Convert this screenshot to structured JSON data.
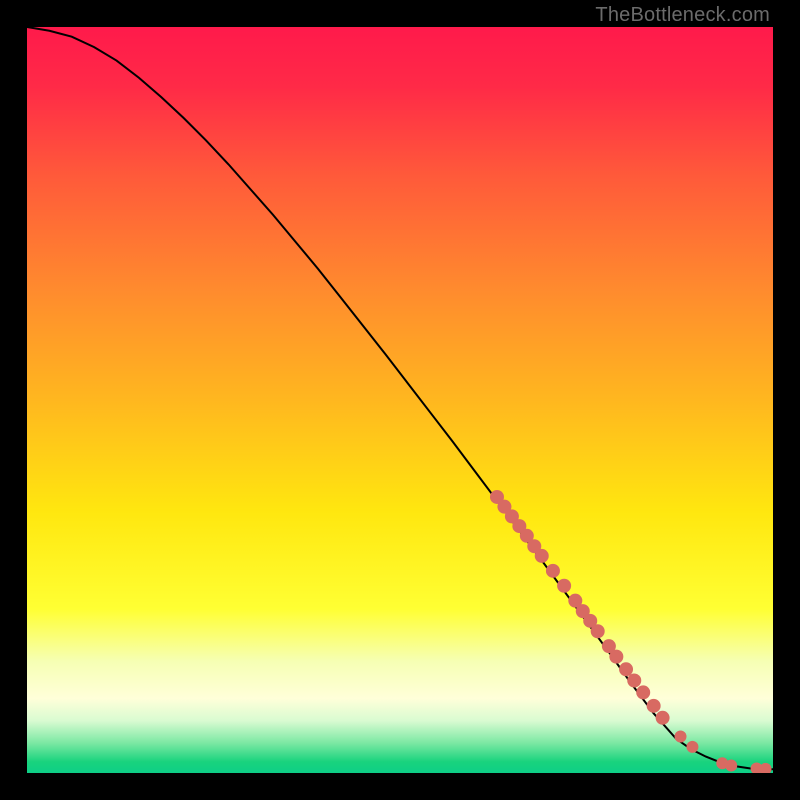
{
  "watermark": "TheBottleneck.com",
  "chart_data": {
    "type": "line",
    "title": "",
    "xlabel": "",
    "ylabel": "",
    "xlim": [
      0,
      100
    ],
    "ylim": [
      0,
      100
    ],
    "grid": false,
    "background_gradient": [
      {
        "stop": 0.0,
        "color": "#ff1a4b"
      },
      {
        "stop": 0.08,
        "color": "#ff2a47"
      },
      {
        "stop": 0.2,
        "color": "#ff5a3a"
      },
      {
        "stop": 0.35,
        "color": "#ff8a2e"
      },
      {
        "stop": 0.5,
        "color": "#ffb71f"
      },
      {
        "stop": 0.65,
        "color": "#ffe70f"
      },
      {
        "stop": 0.78,
        "color": "#ffff33"
      },
      {
        "stop": 0.85,
        "color": "#f6ffb3"
      },
      {
        "stop": 0.9,
        "color": "#ffffd9"
      },
      {
        "stop": 0.93,
        "color": "#d9fbd1"
      },
      {
        "stop": 0.96,
        "color": "#7be8a3"
      },
      {
        "stop": 0.985,
        "color": "#19d37d"
      },
      {
        "stop": 1.0,
        "color": "#0ecf87"
      }
    ],
    "series": [
      {
        "name": "curve",
        "type": "line",
        "color": "#000000",
        "x": [
          0,
          3,
          6,
          9,
          12,
          15,
          18,
          21,
          24,
          27,
          30,
          33,
          36,
          39,
          42,
          45,
          48,
          51,
          54,
          57,
          60,
          63,
          66,
          69,
          72,
          75,
          78,
          81,
          84,
          87,
          89,
          91,
          93,
          95,
          97,
          99,
          100
        ],
        "y": [
          100,
          99.5,
          98.7,
          97.3,
          95.5,
          93.2,
          90.6,
          87.8,
          84.8,
          81.6,
          78.2,
          74.8,
          71.2,
          67.6,
          63.8,
          60.0,
          56.2,
          52.3,
          48.4,
          44.5,
          40.5,
          36.5,
          32.5,
          28.5,
          24.4,
          20.3,
          16.2,
          12.0,
          8.0,
          4.6,
          3.2,
          2.2,
          1.4,
          0.9,
          0.6,
          0.5,
          0.5
        ]
      },
      {
        "name": "markers",
        "type": "scatter",
        "color": "#d86a62",
        "points": [
          {
            "x": 63.0,
            "y": 37.0,
            "r": 7
          },
          {
            "x": 64.0,
            "y": 35.7,
            "r": 7
          },
          {
            "x": 65.0,
            "y": 34.4,
            "r": 7
          },
          {
            "x": 66.0,
            "y": 33.1,
            "r": 7
          },
          {
            "x": 67.0,
            "y": 31.8,
            "r": 7
          },
          {
            "x": 68.0,
            "y": 30.4,
            "r": 7
          },
          {
            "x": 69.0,
            "y": 29.1,
            "r": 7
          },
          {
            "x": 70.5,
            "y": 27.1,
            "r": 7
          },
          {
            "x": 72.0,
            "y": 25.1,
            "r": 7
          },
          {
            "x": 73.5,
            "y": 23.1,
            "r": 7
          },
          {
            "x": 74.5,
            "y": 21.7,
            "r": 7
          },
          {
            "x": 75.5,
            "y": 20.4,
            "r": 7
          },
          {
            "x": 76.5,
            "y": 19.0,
            "r": 7
          },
          {
            "x": 78.0,
            "y": 17.0,
            "r": 7
          },
          {
            "x": 79.0,
            "y": 15.6,
            "r": 7
          },
          {
            "x": 80.3,
            "y": 13.9,
            "r": 7
          },
          {
            "x": 81.4,
            "y": 12.4,
            "r": 7
          },
          {
            "x": 82.6,
            "y": 10.8,
            "r": 7
          },
          {
            "x": 84.0,
            "y": 9.0,
            "r": 7
          },
          {
            "x": 85.2,
            "y": 7.4,
            "r": 7
          },
          {
            "x": 87.6,
            "y": 4.9,
            "r": 6
          },
          {
            "x": 89.2,
            "y": 3.5,
            "r": 6
          },
          {
            "x": 93.2,
            "y": 1.3,
            "r": 6
          },
          {
            "x": 94.4,
            "y": 1.0,
            "r": 6
          },
          {
            "x": 97.8,
            "y": 0.6,
            "r": 6
          },
          {
            "x": 99.0,
            "y": 0.55,
            "r": 6
          }
        ]
      }
    ]
  }
}
